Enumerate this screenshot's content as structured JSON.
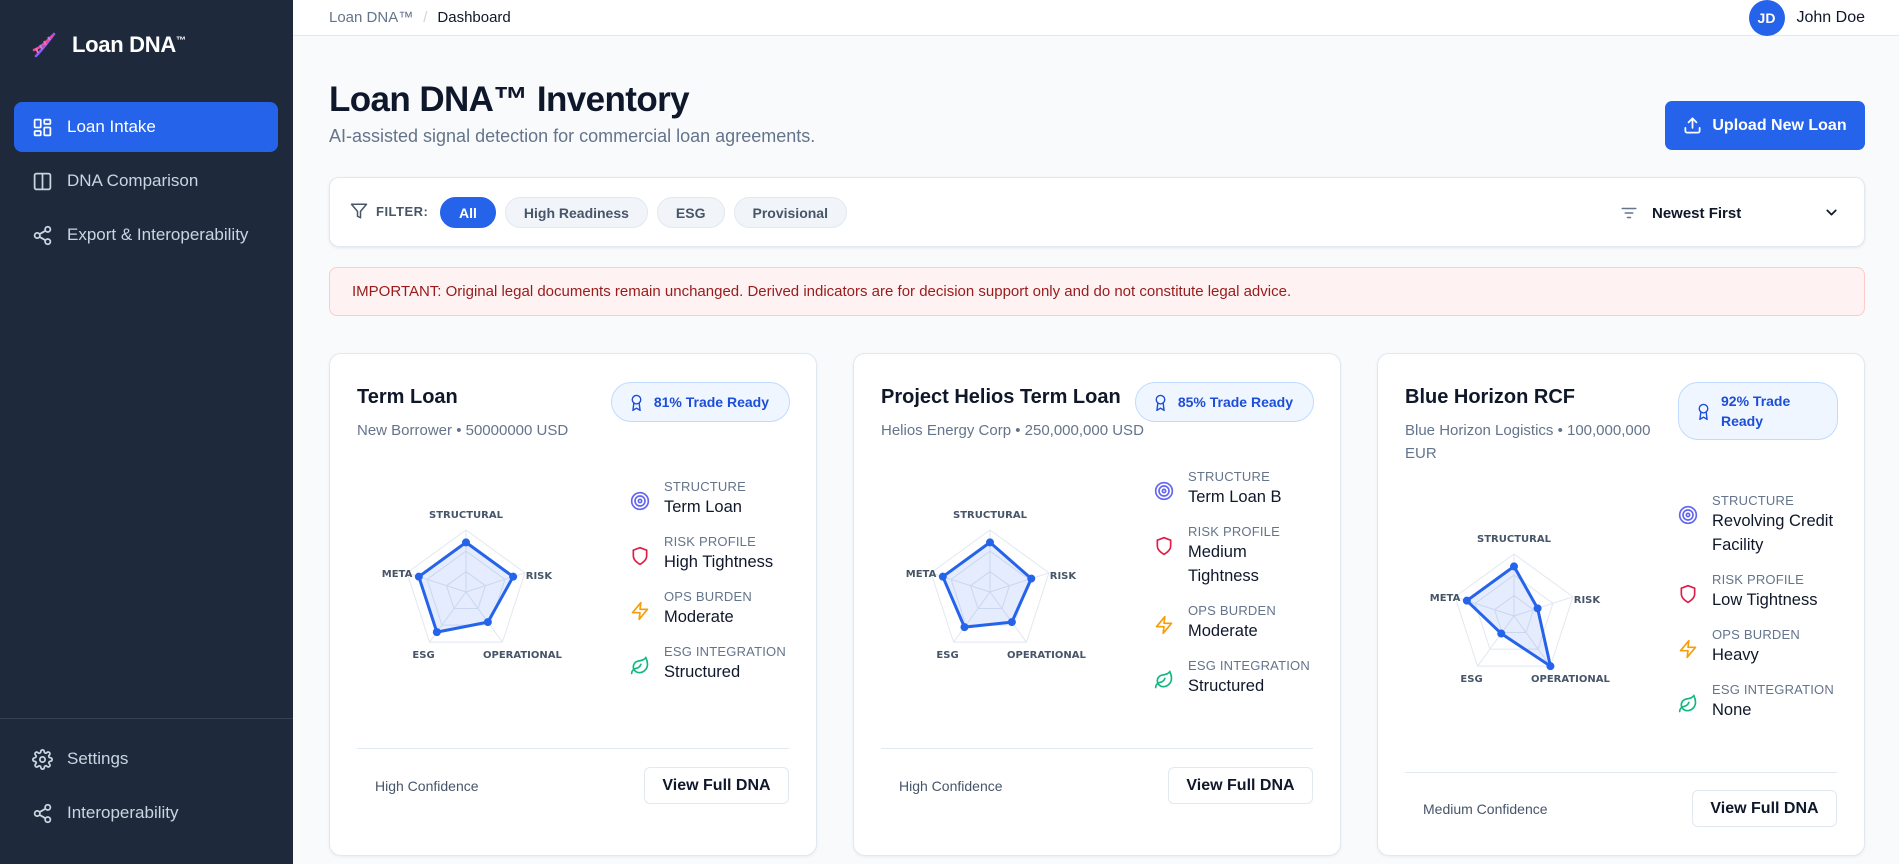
{
  "app": {
    "name": "Loan DNA",
    "tm": "™"
  },
  "sidebar": {
    "items": [
      {
        "label": "Loan Intake",
        "icon": "grid-icon"
      },
      {
        "label": "DNA Comparison",
        "icon": "columns-icon"
      },
      {
        "label": "Export & Interoperability",
        "icon": "share-icon"
      }
    ],
    "bottom": [
      {
        "label": "Settings",
        "icon": "gear-icon"
      },
      {
        "label": "Interoperability",
        "icon": "share-icon"
      }
    ]
  },
  "topbar": {
    "breadcrumb_root": "Loan DNA™",
    "breadcrumb_sep": "/",
    "breadcrumb_current": "Dashboard",
    "user_initials": "JD",
    "user_name": "John Doe"
  },
  "header": {
    "title": "Loan DNA™ Inventory",
    "subtitle": "AI-assisted signal detection for commercial loan agreements.",
    "upload_label": "Upload New Loan"
  },
  "filters": {
    "label": "FILTER:",
    "chips": [
      "All",
      "High Readiness",
      "ESG",
      "Provisional"
    ],
    "active": "All",
    "sort_label": "Newest First"
  },
  "notice": "IMPORTANT: Original legal documents remain unchanged. Derived indicators are for decision support only and do not constitute legal advice.",
  "cards": [
    {
      "title": "Term Loan",
      "subtitle": "New Borrower • 50000000 USD",
      "badge": "81% Trade Ready",
      "radar": {
        "structural": 0.8,
        "risk": 0.8,
        "operational": 0.6,
        "esg": 0.8,
        "meta": 0.8
      },
      "metrics": [
        {
          "label": "Structure",
          "value": "Term Loan"
        },
        {
          "label": "Risk Profile",
          "value": "High Tightness"
        },
        {
          "label": "Ops Burden",
          "value": "Moderate"
        },
        {
          "label": "ESG Integration",
          "value": "Structured"
        }
      ],
      "confidence": "High Confidence",
      "action": "View Full DNA"
    },
    {
      "title": "Project Helios Term Loan",
      "subtitle": "Helios Energy Corp • 250,000,000 USD",
      "badge": "85% Trade Ready",
      "radar": {
        "structural": 0.8,
        "risk": 0.7,
        "operational": 0.6,
        "esg": 0.7,
        "meta": 0.8
      },
      "metrics": [
        {
          "label": "Structure",
          "value": "Term Loan B"
        },
        {
          "label": "Risk Profile",
          "value": "Medium Tightness"
        },
        {
          "label": "Ops Burden",
          "value": "Moderate"
        },
        {
          "label": "ESG Integration",
          "value": "Structured"
        }
      ],
      "confidence": "High Confidence",
      "action": "View Full DNA"
    },
    {
      "title": "Blue Horizon RCF",
      "subtitle": "Blue Horizon Logistics • 100,000,000 EUR",
      "badge": "92% Trade Ready",
      "radar": {
        "structural": 0.8,
        "risk": 0.4,
        "operational": 1.0,
        "esg": 0.35,
        "meta": 0.8
      },
      "metrics": [
        {
          "label": "Structure",
          "value": "Revolving Credit Facility"
        },
        {
          "label": "Risk Profile",
          "value": "Low Tightness"
        },
        {
          "label": "Ops Burden",
          "value": "Heavy"
        },
        {
          "label": "ESG Integration",
          "value": "None"
        }
      ],
      "confidence": "Medium Confidence",
      "action": "View Full DNA"
    }
  ],
  "radar_axes": [
    "STRUCTURAL",
    "RISK",
    "OPERATIONAL",
    "ESG",
    "META"
  ],
  "colors": {
    "accent": "#2563eb",
    "sidebar": "#1e293b",
    "danger": "#991b1b"
  }
}
